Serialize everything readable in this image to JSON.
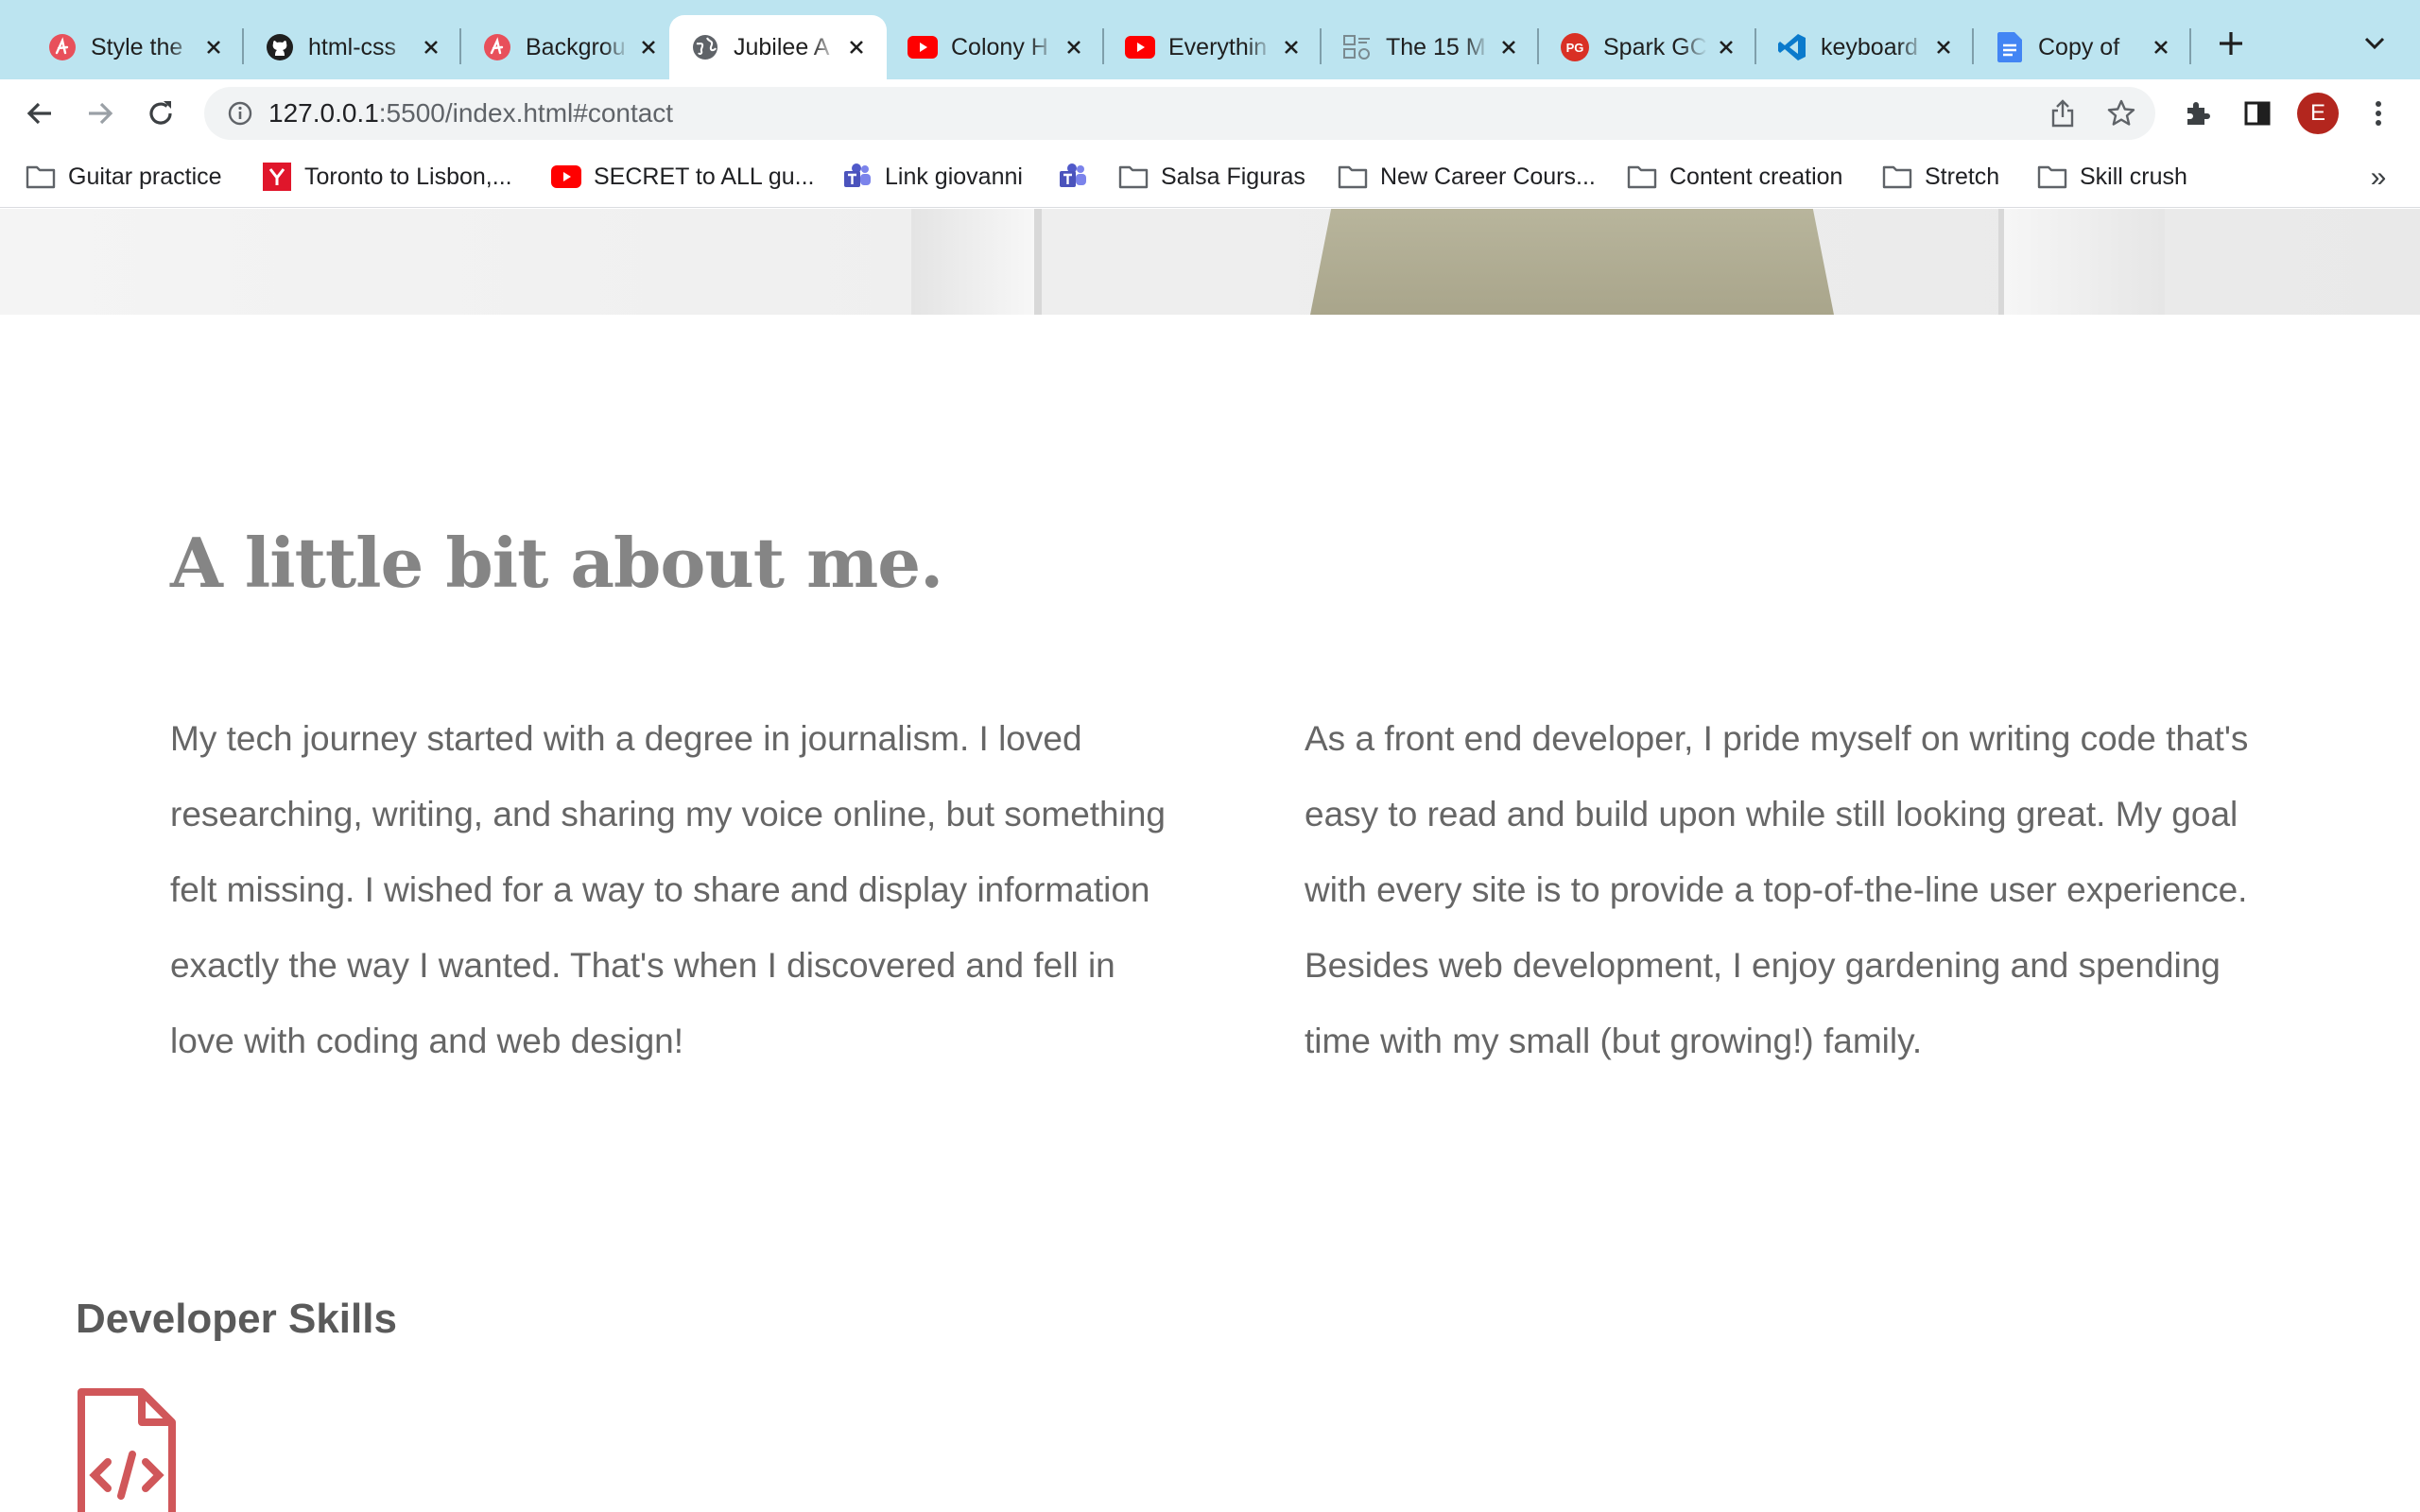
{
  "browser": {
    "tabs": [
      {
        "title": "Style the",
        "icon": "skillcrush-icon"
      },
      {
        "title": "html-css",
        "icon": "github-icon"
      },
      {
        "title": "Backgrou",
        "icon": "skillcrush-icon"
      },
      {
        "title": "Jubilee A",
        "icon": "globe-icon",
        "active": true
      },
      {
        "title": "Colony H",
        "icon": "youtube-icon"
      },
      {
        "title": "Everythin",
        "icon": "youtube-icon"
      },
      {
        "title": "The 15 M",
        "icon": "grid-icon"
      },
      {
        "title": "Spark GC",
        "icon": "pg-icon"
      },
      {
        "title": "keyboard",
        "icon": "vscode-icon"
      },
      {
        "title": "Copy of",
        "icon": "docs-icon"
      }
    ],
    "pg_badge": "PG",
    "url_host": "127.0.0.1",
    "url_path": ":5500/index.html#contact",
    "profile_initial": "E",
    "bookmarks": [
      {
        "label": "Guitar practice",
        "icon": "folder-icon"
      },
      {
        "label": "Toronto to Lisbon,...",
        "icon": "yelp-icon"
      },
      {
        "label": "SECRET to ALL gu...",
        "icon": "youtube-icon"
      },
      {
        "label": "Link giovanni",
        "icon": "teams-icon"
      },
      {
        "label": "",
        "icon": "teams-icon"
      },
      {
        "label": "Salsa Figuras",
        "icon": "folder-icon"
      },
      {
        "label": "New Career Cours...",
        "icon": "folder-icon"
      },
      {
        "label": "Content creation",
        "icon": "folder-icon"
      },
      {
        "label": "Stretch",
        "icon": "folder-icon"
      },
      {
        "label": "Skill crush",
        "icon": "folder-icon"
      }
    ],
    "bookmarks_overflow": "»"
  },
  "page": {
    "about_title": "A little bit about me.",
    "about_left": "My tech journey started with a degree in journalism. I loved researching, writing, and sharing my voice online, but something felt missing. I wished for a way to share and display information exactly the way I wanted. That's when I discovered and fell in love with coding and web design!",
    "about_right": "As a front end developer, I pride myself on writing code that's easy to read and build upon while still looking great. My goal with every site is to provide a top-of-the-line user experience. Besides web development, I enjoy gardening and spending time with my small (but growing!) family.",
    "skills_title": "Developer Skills",
    "skill_icon": "code-file-icon"
  },
  "colors": {
    "tabstrip": "#bce4f0",
    "heading_gray": "#858585",
    "body_gray": "#666666",
    "skill_icon_red": "#d0575a"
  }
}
